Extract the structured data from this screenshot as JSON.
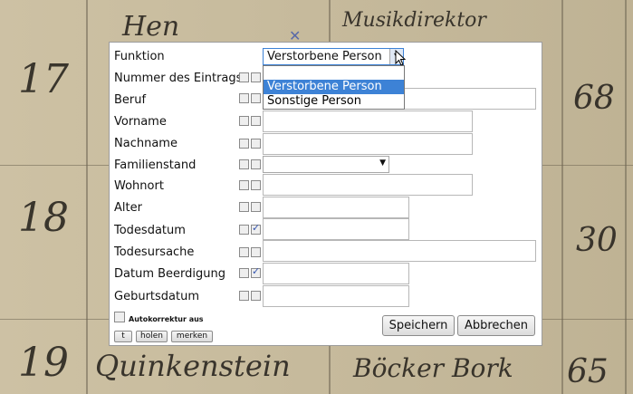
{
  "form": {
    "funktion_label": "Funktion",
    "funktion_value": "Verstorbene Person",
    "funktion_options": [
      "Verstorbene Person",
      "Sonstige Person"
    ],
    "fields": [
      {
        "label": "Nummer des Eintrags",
        "checked": false
      },
      {
        "label": "Beruf",
        "checked": false
      },
      {
        "label": "Vorname",
        "checked": false
      },
      {
        "label": "Nachname",
        "checked": false
      },
      {
        "label": "Familienstand",
        "checked": false
      },
      {
        "label": "Wohnort",
        "checked": false
      },
      {
        "label": "Alter",
        "checked": false
      },
      {
        "label": "Todesdatum",
        "checked": true
      },
      {
        "label": "Todesursache",
        "checked": false
      },
      {
        "label": "Datum Beerdigung",
        "checked": true
      },
      {
        "label": "Geburtsdatum",
        "checked": false
      }
    ],
    "familienstand_value": "",
    "autokorrektur_label": "Autokorrektur aus",
    "small_buttons": [
      "t",
      "holen",
      "merken"
    ],
    "save_label": "Speichern",
    "cancel_label": "Abbrechen"
  }
}
